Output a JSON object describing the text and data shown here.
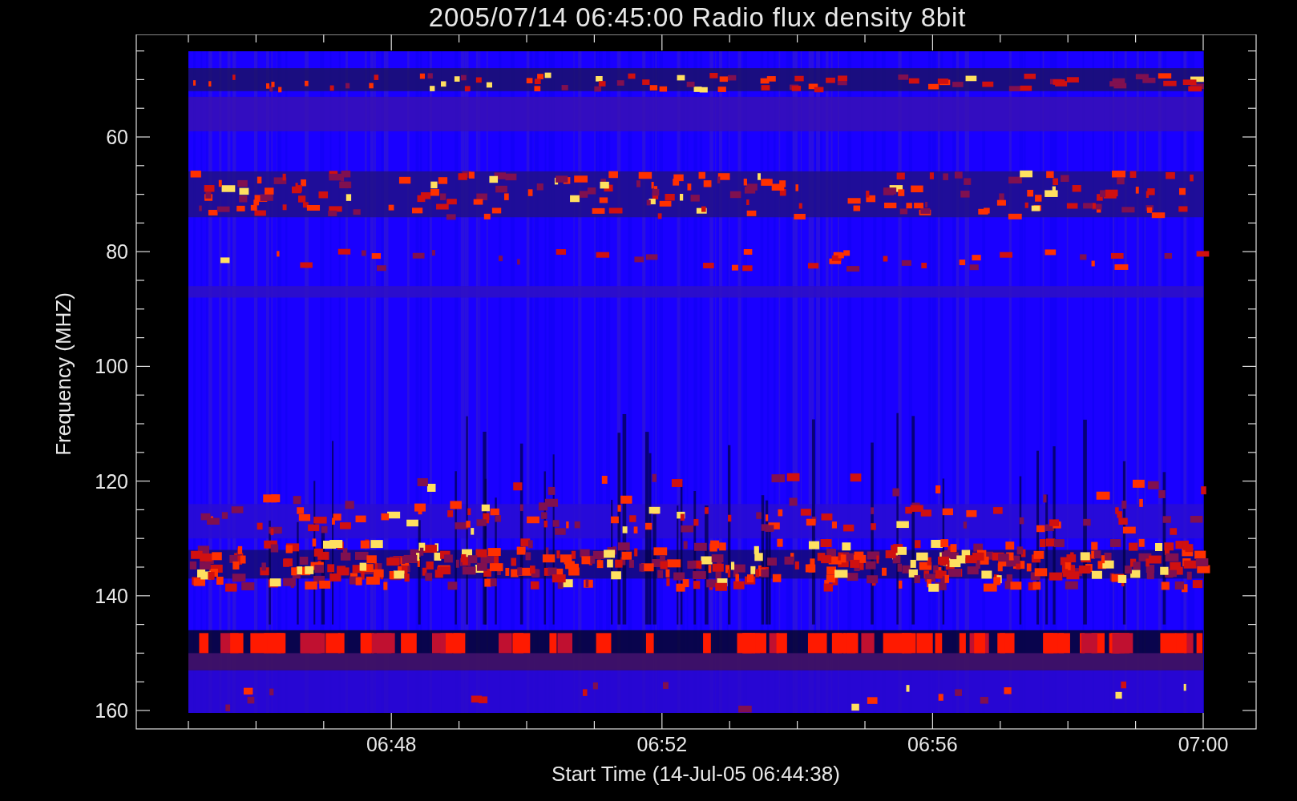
{
  "title": "2005/07/14 06:45:00 Radio flux density 8bit",
  "y_axis": {
    "label": "Frequency (MHZ)",
    "ticks": [
      "60",
      "80",
      "100",
      "120",
      "140",
      "160"
    ]
  },
  "x_axis": {
    "label": "Start Time (14-Jul-05 06:44:38)",
    "ticks": [
      "06:48",
      "06:52",
      "06:56",
      "07:00"
    ]
  }
}
